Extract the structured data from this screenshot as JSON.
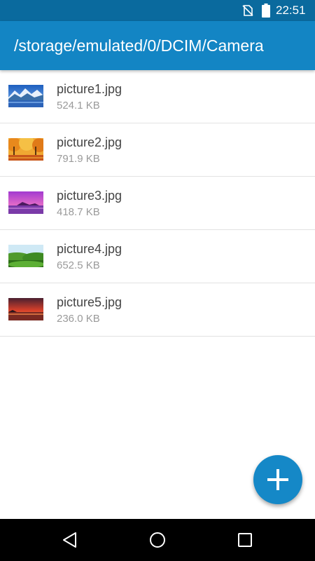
{
  "status_bar": {
    "time": "22:51",
    "icons": [
      "no-sim-icon",
      "battery-icon"
    ]
  },
  "app_bar": {
    "title": "/storage/emulated/0/DCIM/Camera"
  },
  "files": [
    {
      "name": "picture1.jpg",
      "size": "524.1 KB",
      "thumbnail": "mountain-lake-thumbnail"
    },
    {
      "name": "picture2.jpg",
      "size": "791.9 KB",
      "thumbnail": "autumn-park-thumbnail"
    },
    {
      "name": "picture3.jpg",
      "size": "418.7 KB",
      "thumbnail": "purple-sunset-thumbnail"
    },
    {
      "name": "picture4.jpg",
      "size": "652.5 KB",
      "thumbnail": "green-hills-thumbnail"
    },
    {
      "name": "picture5.jpg",
      "size": "236.0 KB",
      "thumbnail": "red-sunset-thumbnail"
    }
  ],
  "fab": {
    "icon": "plus-icon"
  },
  "nav_bar": {
    "icons": [
      "back-icon",
      "home-icon",
      "recents-icon"
    ]
  },
  "colors": {
    "status_bar": "#0a6a9e",
    "app_bar": "#1385c4",
    "accent": "#1588c7",
    "primary_text": "#444444",
    "secondary_text": "#9a9a9a",
    "divider": "#e2e2e2",
    "nav_bar": "#000000"
  }
}
